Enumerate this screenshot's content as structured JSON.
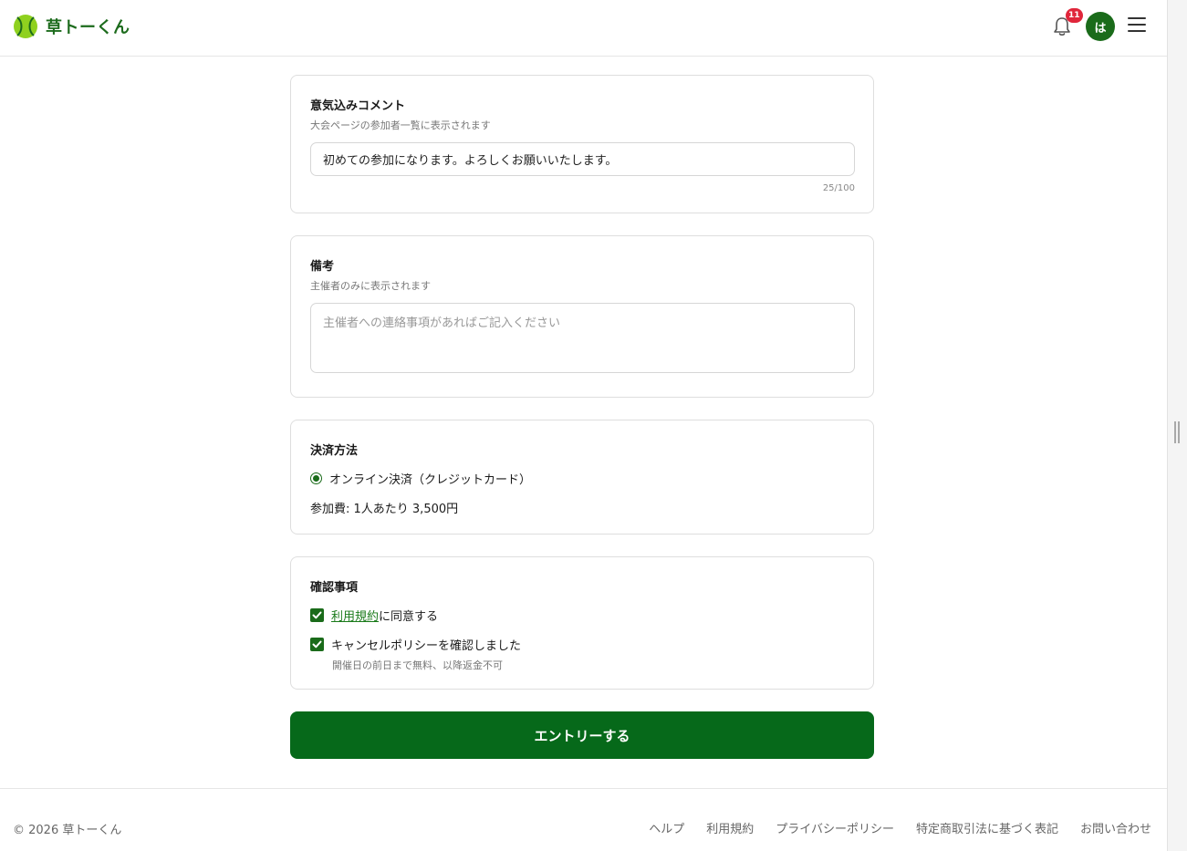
{
  "header": {
    "app_name": "草トーくん",
    "notification_count": "11",
    "avatar_initial": "は"
  },
  "comment_section": {
    "title": "意気込みコメント",
    "subtitle": "大会ページの参加者一覧に表示されます",
    "value": "初めての参加になります。よろしくお願いいたします。",
    "counter": "25/100"
  },
  "remarks_section": {
    "title": "備考",
    "subtitle": "主催者のみに表示されます",
    "placeholder": "主催者への連絡事項があればご記入ください"
  },
  "payment_section": {
    "title": "決済方法",
    "option_label": "オンライン決済（クレジットカード）",
    "fee_text": "参加費: 1人あたり 3,500円"
  },
  "confirm_section": {
    "title": "確認事項",
    "terms_link": "利用規約",
    "terms_suffix": "に同意する",
    "cancel_policy_label": "キャンセルポリシーを確認しました",
    "cancel_policy_note": "開催日の前日まで無料、以降返金不可"
  },
  "submit_label": "エントリーする",
  "footer": {
    "copyright": "© 2026 草トーくん",
    "links": [
      "ヘルプ",
      "利用規約",
      "プライバシーポリシー",
      "特定商取引法に基づく表記",
      "お問い合わせ"
    ]
  },
  "colors": {
    "brand_green": "#06691a",
    "badge_red": "#e0263b"
  }
}
